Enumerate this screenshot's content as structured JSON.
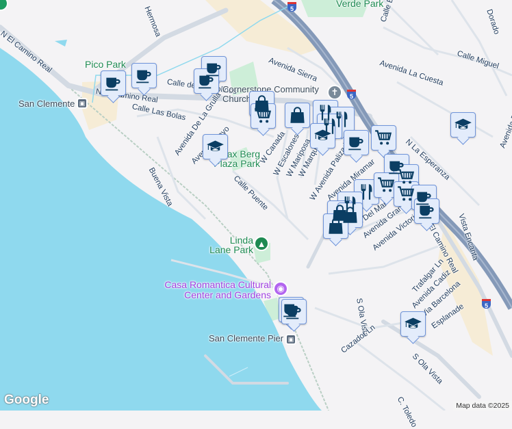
{
  "map": {
    "labels": {
      "el_camino_nw": "N El Camino Real",
      "n_camino": "N El Camino Real",
      "pico_park": "Pico Park",
      "san_clemente": "San Clemente",
      "calle_las_bolas": "Calle Las Bolas",
      "calle_de": "Calle de los Molinos",
      "avenida_de_la_grulla": "Avenida De La Grulla",
      "avenida_mayo": "Avenida Mayo",
      "max_berg": "Max Berg Plaza Park",
      "buena_vista": "Buena Vista",
      "calle_puente": "Calle Puente",
      "w_canada": "W Canada",
      "w_escalones": "W Escalones",
      "w_mariposa": "W Mariposa",
      "w_marquita": "W Marquita",
      "w_avenida_palizada": "W Avenida Palizada",
      "avenida_miramar": "Avenida Miramar",
      "avenida_del_mar": "Avenida Del Mar",
      "avenida_granada": "Avenida Granada",
      "avenida_victoria": "Avenida Victoria",
      "el_camino_real": "El Camino Real",
      "cornerstone": "Cornerstone Community Church",
      "avenida_sierra": "Avenida Sierra",
      "verde_park": "Verde Park",
      "calle_miguel": "Calle Miguel",
      "avenida_la_cuesta": "Avenida La Cuesta",
      "n_la_esperanza": "N La Esperanza",
      "vista_encanta": "Vista Encanta",
      "avenida_p": "Avenida P",
      "calle_e": "Calle E",
      "dorado": "Dorado",
      "mosa": "Hermosa",
      "linda_lane": "Linda Lane Park",
      "casa_romantica": "Casa Romantica Cultural Center and Gardens",
      "pier": "San Clemente Pier",
      "s_ola_vista": "S Ola Vista",
      "s_ola_vista_2": "S Ola Vista",
      "cazador": "Cazador Ln",
      "trafalgar": "Trafalgar Ln",
      "avenida_cadiz": "Avenida Cadiz",
      "barcelona": "Via Barcelona",
      "esplanade": "Esplanade",
      "c_toledo": "C. Toledo",
      "i5": "5"
    },
    "attribution": "Map data ©2025",
    "logo": "Google",
    "colors": {
      "water": "#8fd9ee",
      "land": "#f4f3f5",
      "freeway": "#8499b8",
      "marker_fill": "#e3ecfb",
      "marker_icon": "#0b3e63"
    }
  }
}
